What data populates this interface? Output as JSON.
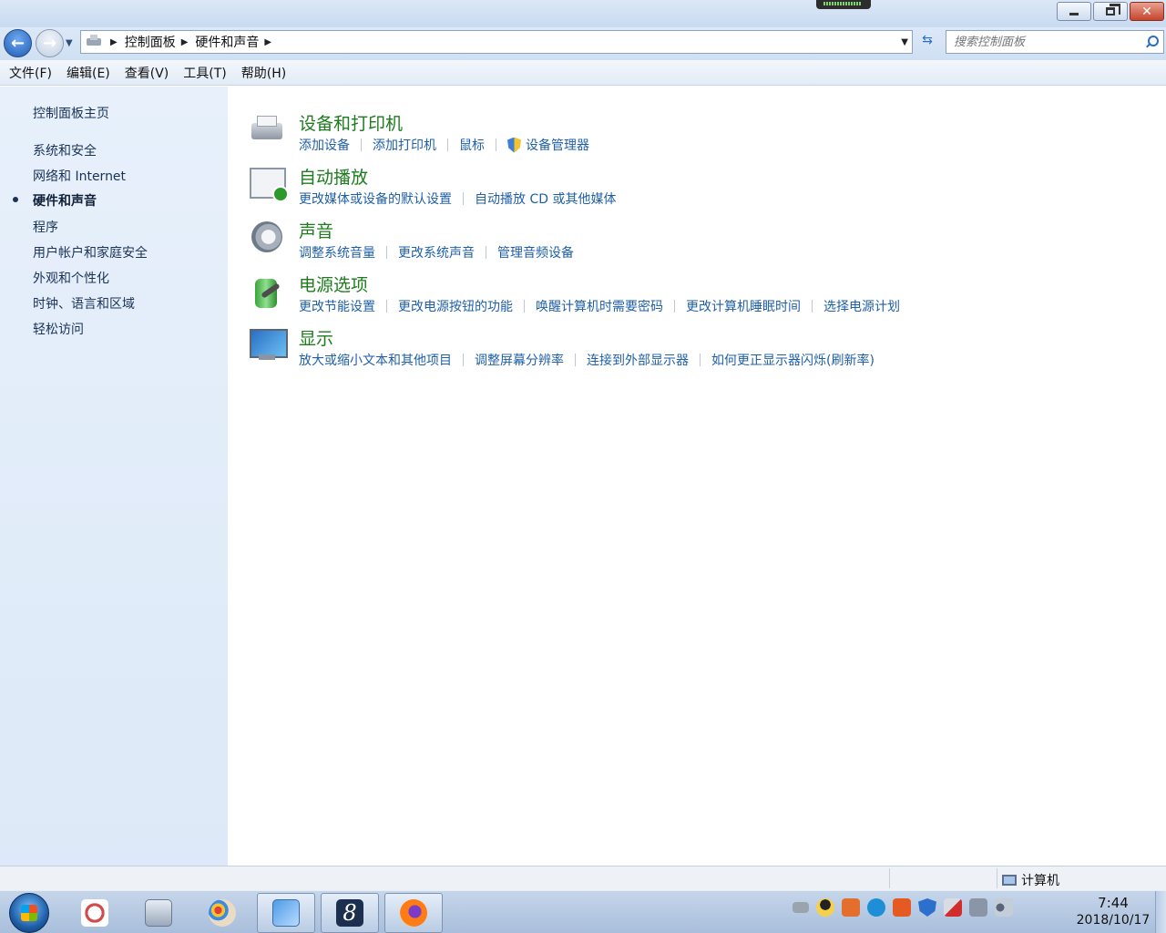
{
  "window": {
    "breadcrumbs": [
      "控制面板",
      "硬件和声音"
    ],
    "search_placeholder": "搜索控制面板"
  },
  "menubar": [
    "文件(F)",
    "编辑(E)",
    "查看(V)",
    "工具(T)",
    "帮助(H)"
  ],
  "sidebar": {
    "home": "控制面板主页",
    "items": [
      {
        "label": "系统和安全",
        "active": false
      },
      {
        "label": "网络和 Internet",
        "active": false
      },
      {
        "label": "硬件和声音",
        "active": true
      },
      {
        "label": "程序",
        "active": false
      },
      {
        "label": "用户帐户和家庭安全",
        "active": false
      },
      {
        "label": "外观和个性化",
        "active": false
      },
      {
        "label": "时钟、语言和区域",
        "active": false
      },
      {
        "label": "轻松访问",
        "active": false
      }
    ]
  },
  "categories": [
    {
      "title": "设备和打印机",
      "icon": "printer-icon",
      "links": [
        "添加设备",
        "添加打印机",
        "鼠标",
        "设备管理器"
      ]
    },
    {
      "title": "自动播放",
      "icon": "autoplay-icon",
      "links": [
        "更改媒体或设备的默认设置",
        "自动播放 CD 或其他媒体"
      ]
    },
    {
      "title": "声音",
      "icon": "speaker-icon",
      "links": [
        "调整系统音量",
        "更改系统声音",
        "管理音频设备"
      ]
    },
    {
      "title": "电源选项",
      "icon": "battery-icon",
      "links": [
        "更改节能设置",
        "更改电源按钮的功能",
        "唤醒计算机时需要密码",
        "更改计算机睡眠时间",
        "选择电源计划"
      ]
    },
    {
      "title": "显示",
      "icon": "monitor-icon",
      "links": [
        "放大或缩小文本和其他项目",
        "调整屏幕分辨率",
        "连接到外部显示器",
        "如何更正显示器闪烁(刷新率)"
      ]
    }
  ],
  "statusbar": {
    "location": "计算机"
  },
  "taskbar": {
    "time": "7:44",
    "date": "2018/10/17"
  }
}
